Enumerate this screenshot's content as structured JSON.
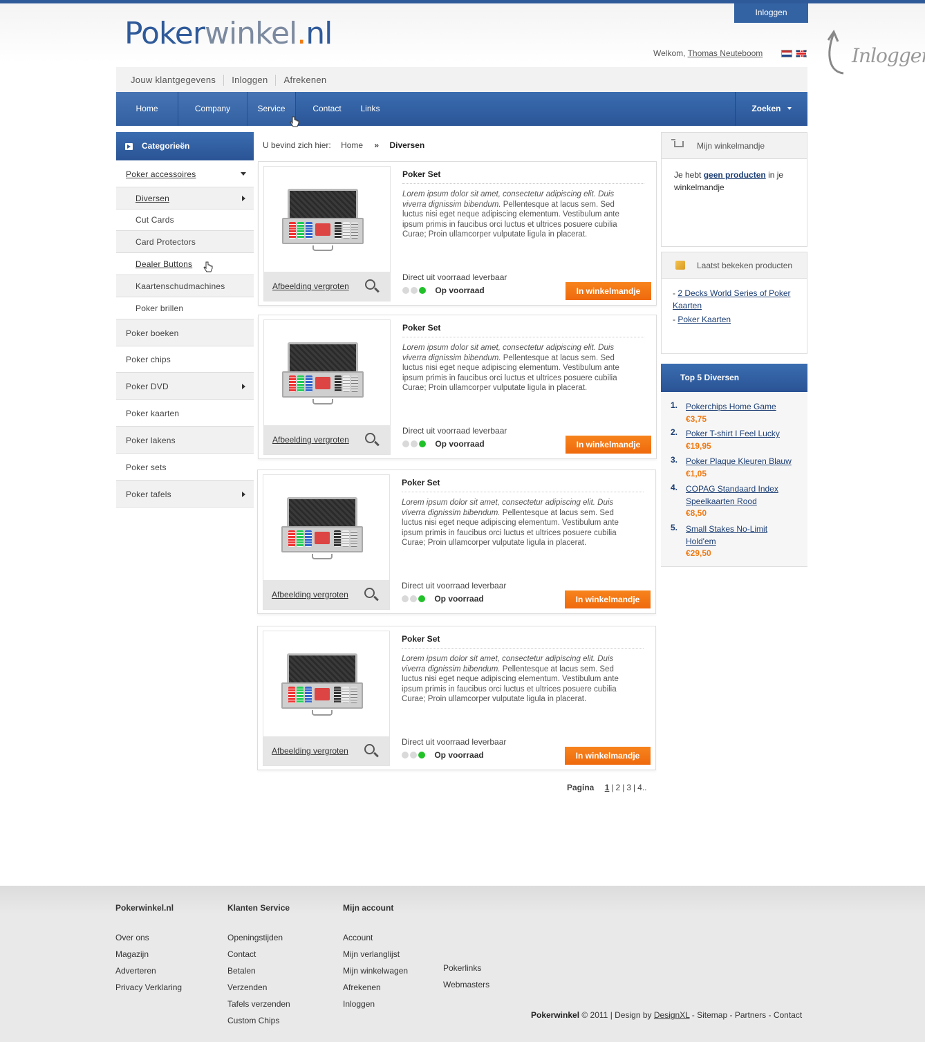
{
  "header": {
    "login_tab": "Inloggen",
    "logo_part1": "Poker",
    "logo_part2": "winkel",
    "logo_dot": ".",
    "logo_part3": "nl",
    "welcome_prefix": "Welkom,",
    "welcome_user": "Thomas Neuteboom",
    "side_login": "Inloggen"
  },
  "submenu": [
    "Jouw klantgegevens",
    "Inloggen",
    "Afrekenen"
  ],
  "nav": {
    "items": [
      "Home",
      "Company",
      "Service",
      "Contact",
      "Links"
    ],
    "search": "Zoeken"
  },
  "sidebar": {
    "title": "Categorieën",
    "items": [
      {
        "label": "Poker accessoires",
        "level": 0
      },
      {
        "label": "Diversen",
        "level": 1
      },
      {
        "label": "Cut Cards",
        "level": 1
      },
      {
        "label": "Card Protectors",
        "level": 1
      },
      {
        "label": "Dealer Buttons",
        "level": 1
      },
      {
        "label": "Kaartenschudmachines",
        "level": 1
      },
      {
        "label": "Poker brillen",
        "level": 1
      },
      {
        "label": "Poker boeken",
        "level": 0
      },
      {
        "label": "Poker chips",
        "level": 0
      },
      {
        "label": "Poker DVD",
        "level": 0
      },
      {
        "label": "Poker kaarten",
        "level": 0
      },
      {
        "label": "Poker lakens",
        "level": 0
      },
      {
        "label": "Poker sets",
        "level": 0
      },
      {
        "label": "Poker tafels",
        "level": 0
      }
    ]
  },
  "breadcrumb": {
    "prefix": "U bevind zich hier:",
    "home": "Home",
    "sep": "»",
    "current": "Diversen"
  },
  "products": [
    {
      "title": "Poker Set",
      "desc_italic": "Lorem ipsum dolor sit amet, consectetur adipiscing elit. Duis viverra dignissim bibendum.",
      "desc": " Pellentesque at lacus sem. Sed luctus nisi eget neque adipiscing elementum. Vestibulum ante ipsum primis in faucibus orci luctus et ultrices posuere cubilia Curae; Proin ullamcorper vulputate ligula in placerat.",
      "zoom": "Afbeelding vergroten",
      "delivery": "Direct uit voorraad leverbaar",
      "stock": "Op voorraad",
      "buy": "In winkelmandje"
    },
    {
      "title": "Poker Set",
      "desc_italic": "Lorem ipsum dolor sit amet, consectetur adipiscing elit. Duis viverra dignissim bibendum.",
      "desc": " Pellentesque at lacus sem. Sed luctus nisi eget neque adipiscing elementum. Vestibulum ante ipsum primis in faucibus orci luctus et ultrices posuere cubilia Curae; Proin ullamcorper vulputate ligula in placerat.",
      "zoom": "Afbeelding vergroten",
      "delivery": "Direct uit voorraad leverbaar",
      "stock": "Op voorraad",
      "buy": "In winkelmandje"
    },
    {
      "title": "Poker Set",
      "desc_italic": "Lorem ipsum dolor sit amet, consectetur adipiscing elit. Duis viverra dignissim bibendum.",
      "desc": " Pellentesque at lacus sem. Sed luctus nisi eget neque adipiscing elementum. Vestibulum ante ipsum primis in faucibus orci luctus et ultrices posuere cubilia Curae; Proin ullamcorper vulputate ligula in placerat.",
      "zoom": "Afbeelding vergroten",
      "delivery": "Direct uit voorraad leverbaar",
      "stock": "Op voorraad",
      "buy": "In winkelmandje"
    },
    {
      "title": "Poker Set",
      "desc_italic": "Lorem ipsum dolor sit amet, consectetur adipiscing elit. Duis viverra dignissim bibendum.",
      "desc": " Pellentesque at lacus sem. Sed luctus nisi eget neque adipiscing elementum. Vestibulum ante ipsum primis in faucibus orci luctus et ultrices posuere cubilia Curae; Proin ullamcorper vulputate ligula in placerat.",
      "zoom": "Afbeelding vergroten",
      "delivery": "Direct uit voorraad leverbaar",
      "stock": "Op voorraad",
      "buy": "In winkelmandje"
    }
  ],
  "paging": {
    "label": "Pagina",
    "pages": [
      "1",
      "2",
      "3",
      "4.."
    ]
  },
  "cart": {
    "title": "Mijn winkelmandje",
    "text_pre": "Je hebt",
    "text_link": "geen producten",
    "text_post": "in je winkelmandje"
  },
  "recent": {
    "title": "Laatst bekeken producten",
    "items": [
      "2 Decks World Series of Poker Kaarten",
      "Poker Kaarten"
    ]
  },
  "top5": {
    "title": "Top 5 Diversen",
    "items": [
      {
        "n": "1.",
        "name": "Pokerchips Home Game",
        "price": "€3,75"
      },
      {
        "n": "2.",
        "name": "Poker T-shirt I Feel Lucky",
        "price": "€19,95"
      },
      {
        "n": "3.",
        "name": "Poker Plaque Kleuren Blauw",
        "price": "€1,05"
      },
      {
        "n": "4.",
        "name": "COPAG Standaard Index Speelkaarten Rood",
        "price": "€8,50"
      },
      {
        "n": "5.",
        "name": "Small Stakes No-Limit Hold'em",
        "price": "€29,50"
      }
    ]
  },
  "footer": {
    "col1": {
      "title": "Pokerwinkel.nl",
      "items": [
        "Over ons",
        "Magazijn",
        "Adverteren",
        "Privacy Verklaring"
      ]
    },
    "col2": {
      "title": "Klanten Service",
      "items": [
        "Openingstijden",
        "Contact",
        "Betalen",
        "Verzenden",
        "Tafels verzenden",
        "Custom Chips"
      ]
    },
    "col3": {
      "title": "Mijn account",
      "items": [
        "Account",
        "Mijn verlanglijst",
        "Mijn winkelwagen",
        "Afrekenen",
        "Inloggen"
      ]
    },
    "col4": {
      "items": [
        "Pokerlinks",
        "Webmasters"
      ]
    },
    "copyright": {
      "brand": "Pokerwinkel",
      "text": "© 2011 | Design by",
      "designer": "DesignXL",
      "links": "- Sitemap - Partners - Contact"
    }
  },
  "colors": {
    "primary_blue": "#2f5a9a",
    "accent_orange": "#f07a12",
    "stock_green": "#22c12a"
  }
}
